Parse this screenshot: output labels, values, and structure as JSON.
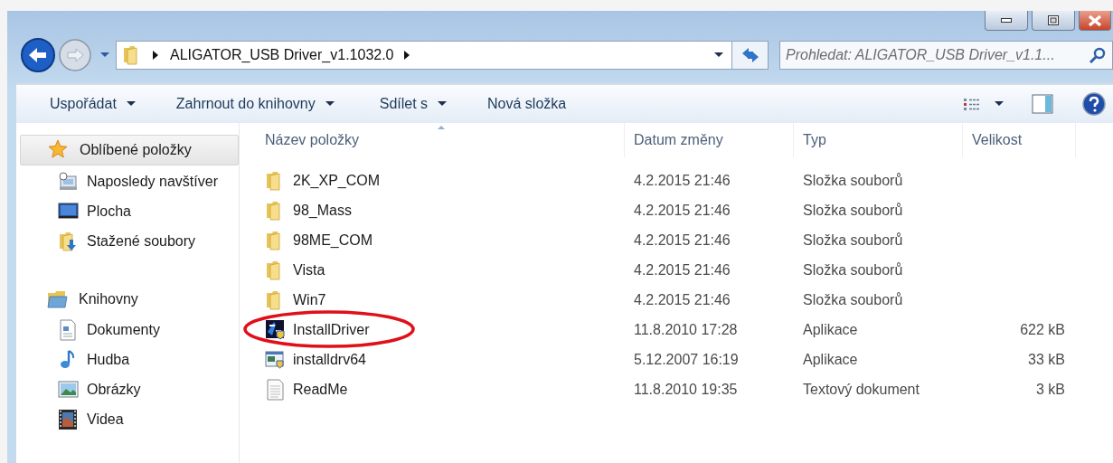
{
  "window": {
    "controls": [
      {
        "kind": "minimize"
      },
      {
        "kind": "maximize"
      },
      {
        "kind": "close"
      }
    ]
  },
  "navigation": {
    "forward_disabled": true,
    "path": [
      "ALIGATOR_USB Driver_v1.1032.0"
    ],
    "search": {
      "placeholder": "Prohledat: ALIGATOR_USB Driver_v1.1..."
    }
  },
  "toolbar": {
    "items": [
      {
        "label": "Uspořádat",
        "dropdown": true
      },
      {
        "label": "Zahrnout do knihovny",
        "dropdown": true
      },
      {
        "label": "Sdílet s",
        "dropdown": true
      },
      {
        "label": "Nová složka",
        "dropdown": false
      }
    ]
  },
  "sidebar": {
    "groups": [
      {
        "label": "Oblíbené položky",
        "kind": "star",
        "selected": true,
        "children": [
          {
            "label": "Naposledy navštíver",
            "kind": "recent",
            "selected": false
          },
          {
            "label": "Plocha",
            "kind": "desktop",
            "selected": false
          },
          {
            "label": "Stažené soubory",
            "kind": "downloads",
            "selected": false
          }
        ]
      },
      {
        "label": "Knihovny",
        "kind": "libraries",
        "selected": false,
        "children": [
          {
            "label": "Dokumenty",
            "kind": "documents",
            "selected": false
          },
          {
            "label": "Hudba",
            "kind": "music",
            "selected": false
          },
          {
            "label": "Obrázky",
            "kind": "pictures",
            "selected": false
          },
          {
            "label": "Videa",
            "kind": "videos",
            "selected": false
          }
        ]
      }
    ]
  },
  "table": {
    "columns": [
      {
        "label": "Název položky",
        "sorted": true
      },
      {
        "label": "Datum změny",
        "sorted": false
      },
      {
        "label": "Typ",
        "sorted": false
      },
      {
        "label": "Velikost",
        "sorted": false
      }
    ],
    "rows": [
      {
        "kind": "folder",
        "name": "2K_XP_COM",
        "date": "4.2.2015 21:46",
        "type": "Složka souborů",
        "circled": false
      },
      {
        "kind": "folder",
        "name": "98_Mass",
        "date": "4.2.2015 21:46",
        "type": "Složka souborů",
        "circled": false
      },
      {
        "kind": "folder",
        "name": "98ME_COM",
        "date": "4.2.2015 21:46",
        "type": "Složka souborů",
        "circled": false
      },
      {
        "kind": "folder",
        "name": "Vista",
        "date": "4.2.2015 21:46",
        "type": "Složka souborů",
        "circled": false
      },
      {
        "kind": "folder",
        "name": "Win7",
        "date": "4.2.2015 21:46",
        "type": "Složka souborů",
        "circled": false
      },
      {
        "kind": "installer",
        "name": "InstallDriver",
        "date": "11.8.2010 17:28",
        "type": "Aplikace",
        "size": "622 kB",
        "circled": true
      },
      {
        "kind": "program",
        "name": "installdrv64",
        "date": "5.12.2007 16:19",
        "type": "Aplikace",
        "size": "33 kB",
        "circled": false
      },
      {
        "kind": "text",
        "name": "ReadMe",
        "date": "11.8.2010 19:35",
        "type": "Textový dokument",
        "size": "3 kB",
        "circled": false
      }
    ]
  }
}
